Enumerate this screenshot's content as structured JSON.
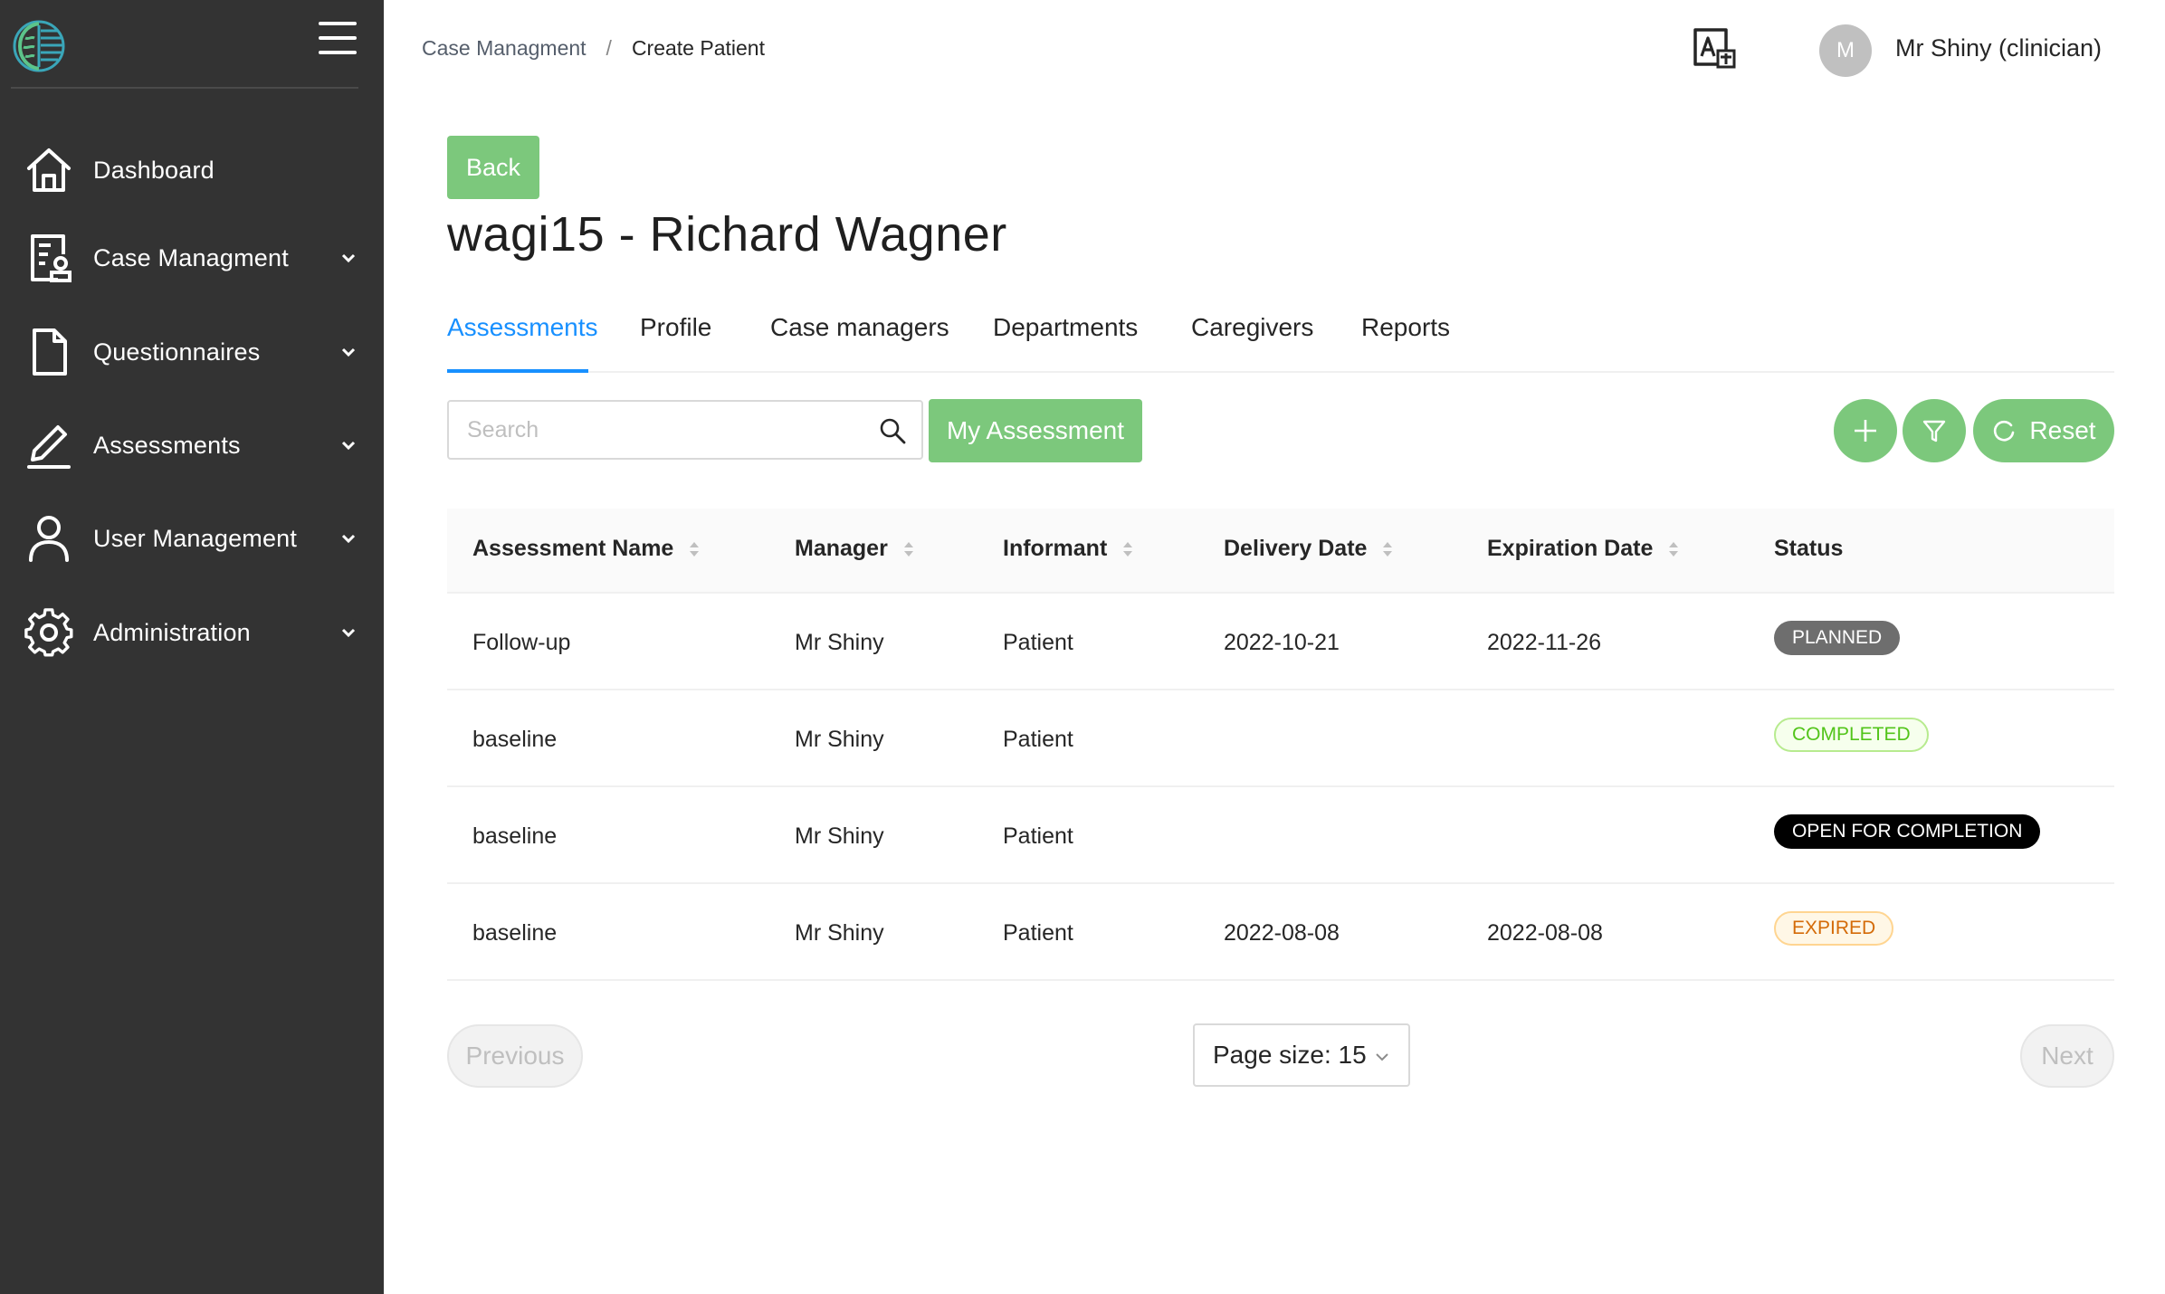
{
  "sidebar": {
    "items": [
      {
        "label": "Dashboard",
        "icon": "home-icon",
        "has_chevron": false
      },
      {
        "label": "Case Managment",
        "icon": "clipboard-user-icon",
        "has_chevron": true
      },
      {
        "label": "Questionnaires",
        "icon": "document-icon",
        "has_chevron": true
      },
      {
        "label": "Assessments",
        "icon": "pencil-icon",
        "has_chevron": true
      },
      {
        "label": "User Management",
        "icon": "user-icon",
        "has_chevron": true
      },
      {
        "label": "Administration",
        "icon": "gear-icon",
        "has_chevron": true
      }
    ]
  },
  "header": {
    "breadcrumb": [
      "Case Managment",
      "Create Patient"
    ],
    "breadcrumb_separator": "/",
    "avatar_initial": "M",
    "user_name": "Mr Shiny (clinician)"
  },
  "main": {
    "back_label": "Back",
    "title": "wagi15 - Richard Wagner",
    "tabs": [
      "Assessments",
      "Profile",
      "Case managers",
      "Departments",
      "Caregivers",
      "Reports"
    ],
    "active_tab": "Assessments",
    "search_placeholder": "Search",
    "my_assessment_label": "My Assessment",
    "reset_label": "Reset"
  },
  "table": {
    "columns": [
      "Assessment Name",
      "Manager",
      "Informant",
      "Delivery Date",
      "Expiration Date",
      "Status"
    ],
    "rows": [
      {
        "name": "Follow-up",
        "manager": "Mr Shiny",
        "informant": "Patient",
        "delivery": "2022-10-21",
        "expiration": "2022-11-26",
        "status": "PLANNED"
      },
      {
        "name": "baseline",
        "manager": "Mr Shiny",
        "informant": "Patient",
        "delivery": "",
        "expiration": "",
        "status": "COMPLETED"
      },
      {
        "name": "baseline",
        "manager": "Mr Shiny",
        "informant": "Patient",
        "delivery": "",
        "expiration": "",
        "status": "OPEN FOR COMPLETION"
      },
      {
        "name": "baseline",
        "manager": "Mr Shiny",
        "informant": "Patient",
        "delivery": "2022-08-08",
        "expiration": "2022-08-08",
        "status": "EXPIRED"
      }
    ]
  },
  "pagination": {
    "previous_label": "Previous",
    "page_size_label": "Page size: 15",
    "next_label": "Next"
  },
  "colors": {
    "sidebar_bg": "#333333",
    "primary_green": "#7cc87c",
    "active_tab_blue": "#1890ff"
  }
}
